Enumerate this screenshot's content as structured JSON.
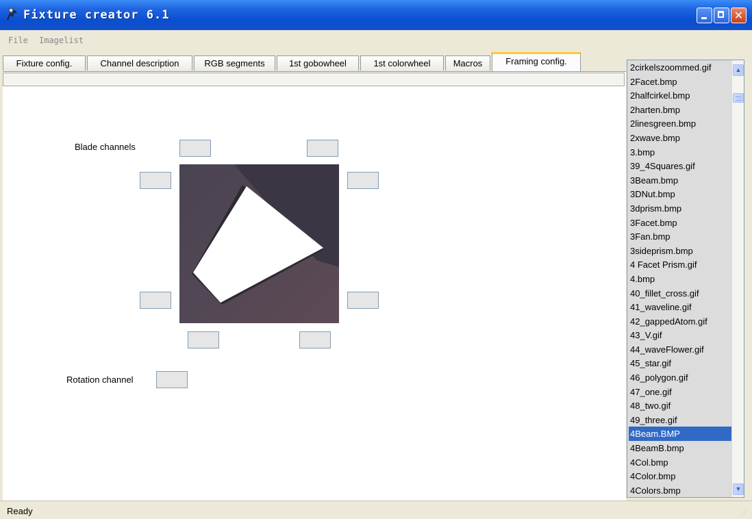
{
  "window": {
    "title": "Fixture creator 6.1",
    "app_icon": "fixture-app-icon"
  },
  "menu": {
    "file": "File",
    "imagelist": "Imagelist"
  },
  "tabs": [
    {
      "label": "Fixture config."
    },
    {
      "label": "Channel description"
    },
    {
      "label": "RGB segments"
    },
    {
      "label": "1st gobowheel"
    },
    {
      "label": "1st colorwheel"
    },
    {
      "label": "Macros"
    },
    {
      "label": "Framing config.",
      "active": true
    }
  ],
  "framing": {
    "blade_channels_label": "Blade channels",
    "rotation_channel_label": "Rotation channel"
  },
  "imagelist": {
    "items": [
      "2cirkelszoommed.gif",
      "2Facet.bmp",
      "2halfcirkel.bmp",
      "2harten.bmp",
      "2linesgreen.bmp",
      "2xwave.bmp",
      "3.bmp",
      "39_4Squares.gif",
      "3Beam.bmp",
      "3DNut.bmp",
      "3dprism.bmp",
      "3Facet.bmp",
      "3Fan.bmp",
      "3sideprism.bmp",
      "4 Facet Prism.gif",
      "4.bmp",
      "40_fillet_cross.gif",
      "41_waveline.gif",
      "42_gappedAtom.gif",
      "43_V.gif",
      "44_waveFlower.gif",
      "45_star.gif",
      "46_polygon.gif",
      "47_one.gif",
      "48_two.gif",
      "49_three.gif",
      "4Beam.BMP",
      "4BeamB.bmp",
      "4Col.bmp",
      "4Color.bmp",
      "4Colors.bmp"
    ],
    "selected": "4Beam.BMP"
  },
  "status": {
    "text": "Ready"
  },
  "colors": {
    "titlebar": "#0a4ed0",
    "selection": "#316ac5",
    "active_tab_accent": "#ffc83c"
  }
}
